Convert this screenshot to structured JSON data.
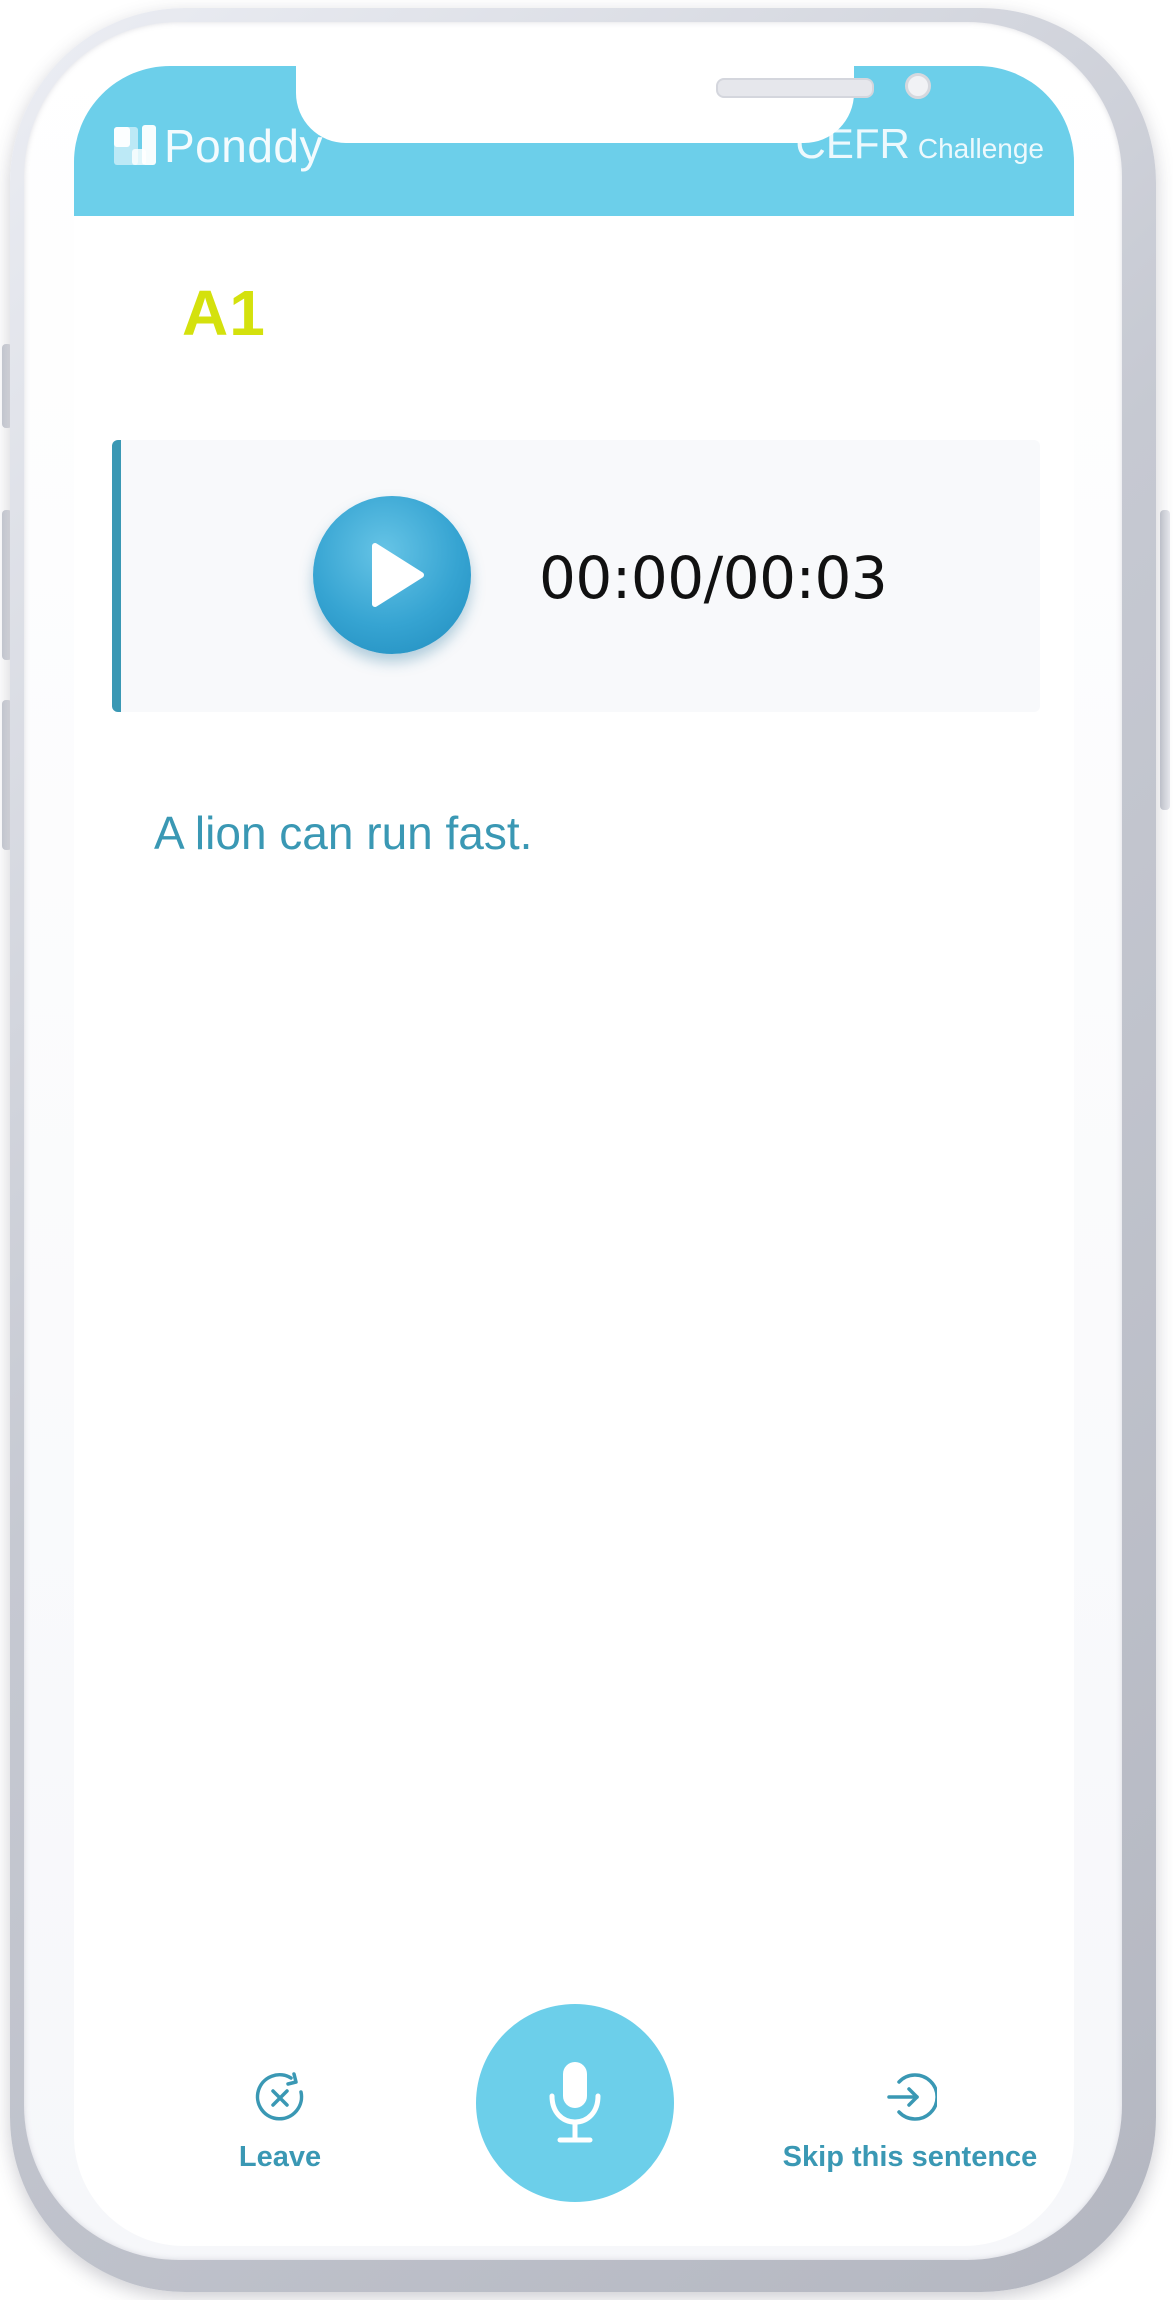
{
  "header": {
    "brand_name": "Ponddy",
    "title_main": "CEFR",
    "title_sub": "Challenge"
  },
  "level": {
    "label": "A1"
  },
  "player": {
    "time_readout": "00:00/00:03",
    "play_icon": "play-icon"
  },
  "sentence": {
    "text": "A lion can run fast."
  },
  "controls": {
    "leave_label": "Leave",
    "leave_icon": "close-circle-icon",
    "mic_icon": "microphone-icon",
    "skip_label": "Skip this sentence",
    "skip_icon": "skip-icon"
  },
  "colors": {
    "header": "#6ccfea",
    "accent": "#3a98b4",
    "level": "#d4e10d",
    "play_button": "#36a4d2"
  }
}
